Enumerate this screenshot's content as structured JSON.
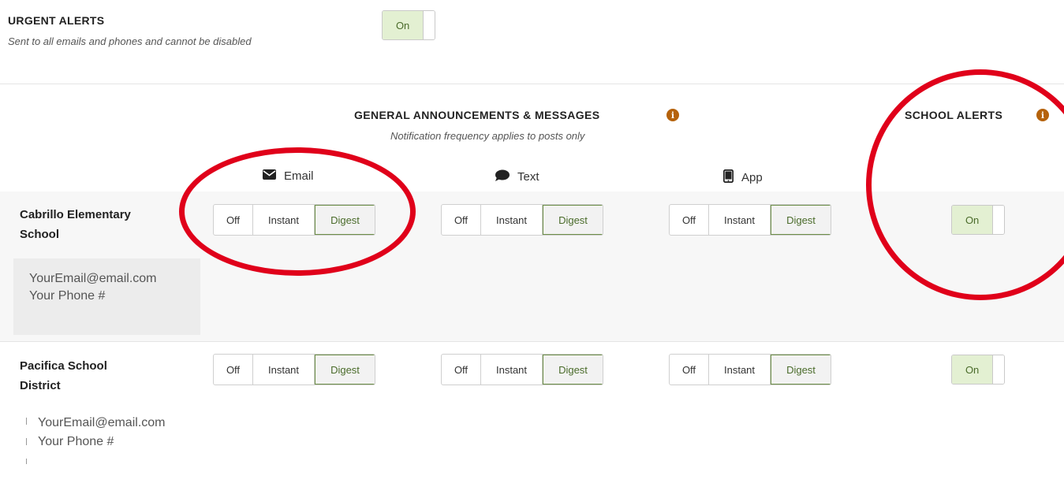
{
  "urgent": {
    "title": "URGENT ALERTS",
    "subtitle": "Sent to all emails and phones and cannot be disabled",
    "toggle_label": "On"
  },
  "general": {
    "heading": "GENERAL ANNOUNCEMENTS & MESSAGES",
    "note": "Notification frequency applies to posts only",
    "info_glyph": "i"
  },
  "school_alerts": {
    "heading": "SCHOOL ALERTS",
    "info_glyph": "i"
  },
  "channels": {
    "email": "Email",
    "text": "Text",
    "app": "App"
  },
  "options": {
    "off": "Off",
    "instant": "Instant",
    "digest": "Digest"
  },
  "schools": [
    {
      "name_line1": "Cabrillo Elementary",
      "name_line2": "School",
      "email": "YourEmail@email.com",
      "phone": "Your Phone #",
      "alerts_toggle": "On",
      "selected": {
        "email": "Digest",
        "text": "Digest",
        "app": "Digest"
      }
    },
    {
      "name_line1": "Pacifica School",
      "name_line2": "District",
      "email": "YourEmail@email.com",
      "phone": "Your Phone #",
      "alerts_toggle": "On",
      "selected": {
        "email": "Digest",
        "text": "Digest",
        "app": "Digest"
      }
    }
  ],
  "colors": {
    "toggle_on_bg": "#e3f0d2",
    "accent_green": "#4a6b2a",
    "info_icon": "#b5620b",
    "annotation_red": "#e0001a"
  },
  "icons": {
    "info": "info-icon",
    "email": "envelope-icon",
    "text": "speech-bubble-icon",
    "app": "phone-icon"
  }
}
